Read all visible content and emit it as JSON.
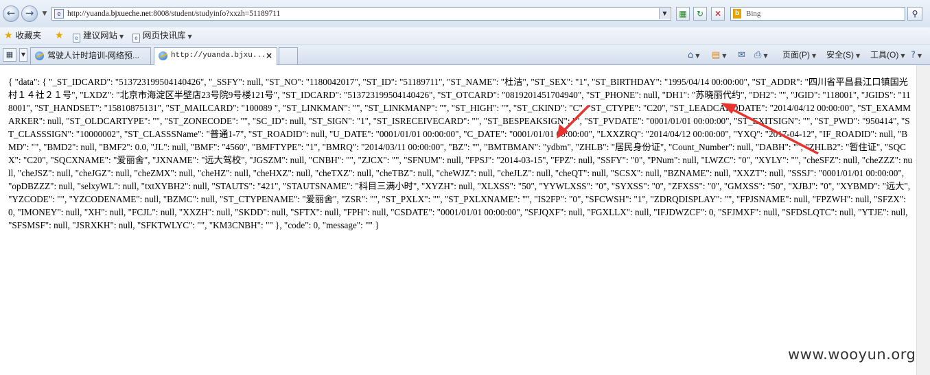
{
  "browser": {
    "url_prefix": "http://yuanda.",
    "url_domain": "bjxueche.net",
    "url_rest": ":8008/student/studyinfo?xxzh=51189711",
    "search_placeholder": "Bing",
    "search_brand": "b"
  },
  "favorites": {
    "label": "收藏夹",
    "items": [
      {
        "label": "建议网站"
      },
      {
        "label": "网页快讯库"
      }
    ]
  },
  "tabs": [
    {
      "label": "驾驶人计时培训-网络预..."
    },
    {
      "label": "http://yuanda.bjxu..."
    }
  ],
  "command_bar": {
    "page": "页面(P)",
    "safety": "安全(S)",
    "tools": "工具(O)",
    "help": "?"
  },
  "content": {
    "json_text": "{ \"data\": { \"_ST_IDCARD\": \"513723199504140426\", \"_SSFY\": null, \"ST_NO\": \"1180042017\", \"ST_ID\": \"51189711\", \"ST_NAME\": \"杜洁\", \"ST_SEX\": \"1\", \"ST_BIRTHDAY\": \"1995/04/14 00:00:00\", \"ST_ADDR\": \"四川省平昌县江口镇国光村１４社２１号\", \"LXDZ\": \"北京市海淀区半壁店23号院9号楼121号\", \"ST_IDCARD\": \"513723199504140426\", \"ST_OTCARD\": \"0819201451704940\", \"ST_PHONE\": null, \"DH1\": \"苏晓丽代约\", \"DH2\": \"\", \"JGID\": \"118001\", \"JGIDS\": \"118001\", \"ST_HANDSET\": \"15810875131\", \"ST_MAILCARD\": \"100089 \", \"ST_LINKMAN\": \"\", \"ST_LINKMANP\": \"\", \"ST_HIGH\": \"\", \"ST_CKIND\": \"C\", \"ST_CTYPE\": \"C20\", \"ST_LEADCARDDATE\": \"2014/04/12 00:00:00\", \"ST_EXAMMARKER\": null, \"ST_OLDCARTYPE\": \"\", \"ST_ZONECODE\": \"\", \"SC_ID\": null, \"ST_SIGN\": \"1\", \"ST_ISRECEIVECARD\": \"\", \"ST_BESPEAKSIGN\": \"\", \"ST_PVDATE\": \"0001/01/01 00:00:00\", \"ST_EXITSIGN\": \"\", \"ST_PWD\": \"950414\", \"ST_CLASSSIGN\": \"10000002\", \"ST_CLASSSName\": \"普通1-7\", \"ST_ROADID\": null, \"U_DATE\": \"0001/01/01 00:00:00\", \"C_DATE\": \"0001/01/01 00:00:00\", \"LXXZRQ\": \"2014/04/12 00:00:00\", \"YXQ\": \"2017-04-12\", \"IF_ROADID\": null, \"BMD\": \"\", \"BMD2\": null, \"BMF2\": 0.0, \"JL\": null, \"BMF\": \"4560\", \"BMFTYPE\": \"1\", \"BMRQ\": \"2014/03/11 00:00:00\", \"BZ\": \"\", \"BMTBMAN\": \"ydbm\", \"ZHLB\": \"居民身份证\", \"Count_Number\": null, \"DABH\": \"\", \"ZHLB2\": \"暂住证\", \"SQCX\": \"C20\", \"SQCXNAME\": \"爱丽舍\", \"JXNAME\": \"远大驾校\", \"JGSZM\": null, \"CNBH\": \"\", \"ZJCX\": \"\", \"SFNUM\": null, \"FPSJ\": \"2014-03-15\", \"FPZ\": null, \"SSFY\": \"0\", \"PNum\": null, \"LWZC\": \"0\", \"XYLY\": \"\", \"cheSFZ\": null, \"cheZZZ\": null, \"cheJSZ\": null, \"cheJGZ\": null, \"cheZMX\": null, \"cheHZ\": null, \"cheHXZ\": null, \"cheTXZ\": null, \"cheTBZ\": null, \"cheWJZ\": null, \"cheJLZ\": null, \"cheQT\": null, \"SCSX\": null, \"BZNAME\": null, \"XXZT\": null, \"SSSJ\": \"0001/01/01 00:00:00\", \"opDBZZZ\": null, \"selxyWL\": null, \"txtXYBH2\": null, \"STAUTS\": \"421\", \"STAUTSNAME\": \"科目三满小时\", \"XYZH\": null, \"XLXSS\": \"50\", \"YYWLXSS\": \"0\", \"SYXSS\": \"0\", \"ZFXSS\": \"0\", \"GMXSS\": \"50\", \"XJBJ\": \"0\", \"XYBMD\": \"远大\", \"YZCODE\": \"\", \"YZCODENAME\": null, \"BZMC\": null, \"ST_CTYPENAME\": \"爱丽舍\", \"ZSR\": \"\", \"ST_PXLX\": \"\", \"ST_PXLXNAME\": \"\", \"IS2FP\": \"0\", \"SFCWSH\": \"1\", \"ZDRQDISPLAY\": \"\", \"FPJSNAME\": null, \"FPZWH\": null, \"SFZX\": 0, \"IMONEY\": null, \"XH\": null, \"FCJL\": null, \"XXZH\": null, \"SKDD\": null, \"SFTX\": null, \"FPH\": null, \"CSDATE\": \"0001/01/01 00:00:00\", \"SFJQXF\": null, \"FGXLLX\": null, \"IFJDWZCF\": 0, \"SFJMXF\": null, \"SFDSLQTC\": null, \"YTJE\": null, \"SFSMSF\": null, \"JSRXKH\": null, \"SFKTWLYC\": \"\", \"KM3CNBH\": \"\" }, \"code\": 0, \"message\": \"\" }"
  },
  "watermark": "www.wooyun.org",
  "colors": {
    "annotation_arrow": "#e8332f"
  }
}
